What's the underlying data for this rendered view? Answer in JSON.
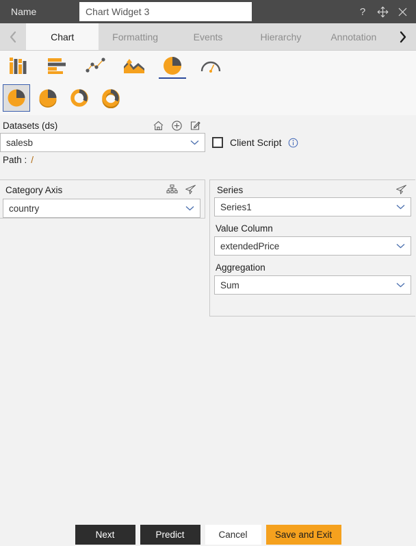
{
  "titlebar": {
    "name_label": "Name",
    "name_value": "Chart Widget 3",
    "name_placeholder": "Name",
    "help_icon": "question-mark-icon",
    "move_icon": "move-arrows-icon",
    "close_icon": "close-icon"
  },
  "tabs": {
    "prev_icon": "chevron-left-icon",
    "next_icon": "chevron-right-icon",
    "items": [
      {
        "label": "Chart",
        "active": true
      },
      {
        "label": "Formatting",
        "active": false
      },
      {
        "label": "Events",
        "active": false
      },
      {
        "label": "Hierarchy",
        "active": false
      },
      {
        "label": "Annotation",
        "active": false
      }
    ]
  },
  "chart_types": [
    {
      "name": "column-chart-icon",
      "selected": false
    },
    {
      "name": "bar-chart-icon",
      "selected": false
    },
    {
      "name": "scatter-line-chart-icon",
      "selected": false
    },
    {
      "name": "area-chart-icon",
      "selected": false
    },
    {
      "name": "pie-chart-icon",
      "selected": true
    },
    {
      "name": "gauge-chart-icon",
      "selected": false
    }
  ],
  "chart_subtypes": [
    {
      "name": "pie-flat-icon",
      "selected": true
    },
    {
      "name": "pie-3d-icon",
      "selected": false
    },
    {
      "name": "donut-flat-icon",
      "selected": false
    },
    {
      "name": "donut-3d-icon",
      "selected": false
    }
  ],
  "datasets": {
    "label": "Datasets (ds)",
    "home_icon": "home-icon",
    "add_icon": "plus-circle-icon",
    "edit_icon": "edit-pencil-icon",
    "value": "salesb",
    "path_label": "Path :",
    "path_value": "/"
  },
  "client_script": {
    "label": "Client Script",
    "checked": false,
    "info_icon": "info-icon"
  },
  "category_axis": {
    "label": "Category Axis",
    "hierarchy_icon": "hierarchy-tree-icon",
    "send_icon": "paper-plane-icon",
    "value": "country"
  },
  "series": {
    "label": "Series",
    "send_icon": "paper-plane-icon",
    "value": "Series1",
    "value_column_label": "Value Column",
    "value_column": "extendedPrice",
    "aggregation_label": "Aggregation",
    "aggregation": "Sum"
  },
  "footer": {
    "next": "Next",
    "predict": "Predict",
    "cancel": "Cancel",
    "save_and_exit": "Save and Exit"
  },
  "colors": {
    "accent_orange": "#f5a11e",
    "icon_gray": "#58595b",
    "titlebar": "#4a4a4a",
    "selected_blue": "#2b4a9b"
  }
}
